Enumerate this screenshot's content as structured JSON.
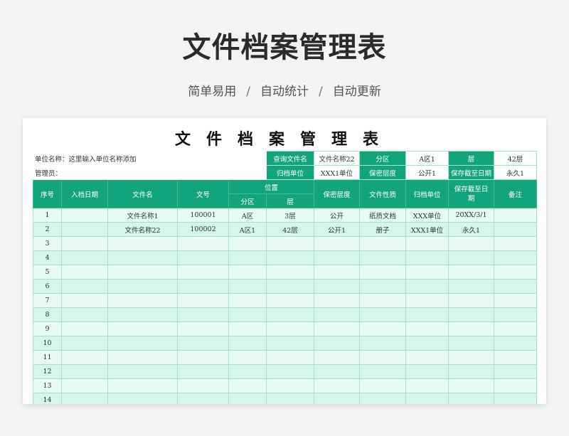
{
  "hero": {
    "title": "文件档案管理表",
    "subtitle_parts": [
      "简单易用",
      "自动统计",
      "自动更新"
    ],
    "separator": "/"
  },
  "sheet": {
    "title": "文件档案管理表",
    "info": {
      "unit_label": "单位名称：这里输入单位名称添加",
      "manager_label": "管理员：",
      "row1": [
        {
          "label": "查询文件名",
          "value": "文件名称22"
        },
        {
          "label": "分区",
          "value": "A区1"
        },
        {
          "label": "层",
          "value": "42层"
        }
      ],
      "row2": [
        {
          "label": "归档单位",
          "value": "XXX1单位"
        },
        {
          "label": "保密层度",
          "value": "公开1"
        },
        {
          "label": "保存截至日期",
          "value": "永久1"
        }
      ]
    },
    "headers": {
      "seq": "序号",
      "date": "入档日期",
      "filename": "文件名",
      "docno": "文号",
      "location": "位置",
      "zone": "分区",
      "floor": "层",
      "secrecy": "保密层度",
      "nature": "文件性质",
      "unit": "归档单位",
      "keep_until": "保存截至日期",
      "remark": "备注"
    },
    "rows": [
      {
        "seq": "1",
        "date": "",
        "filename": "文件名称1",
        "docno": "100001",
        "zone": "A区",
        "floor": "3层",
        "secrecy": "公开",
        "nature": "纸质文档",
        "unit": "XXX单位",
        "keep_until": "20XX/3/1",
        "remark": ""
      },
      {
        "seq": "2",
        "date": "",
        "filename": "文件名称22",
        "docno": "100002",
        "zone": "A区1",
        "floor": "42层",
        "secrecy": "公开1",
        "nature": "册子",
        "unit": "XXX1单位",
        "keep_until": "永久1",
        "remark": ""
      },
      {
        "seq": "3"
      },
      {
        "seq": "4"
      },
      {
        "seq": "5"
      },
      {
        "seq": "6"
      },
      {
        "seq": "7"
      },
      {
        "seq": "8"
      },
      {
        "seq": "9"
      },
      {
        "seq": "10"
      },
      {
        "seq": "11"
      },
      {
        "seq": "12"
      },
      {
        "seq": "13"
      },
      {
        "seq": "14"
      }
    ]
  },
  "colors": {
    "header_green": "#12a57b",
    "row_light": "#e9fbf5",
    "row_alt": "#d3f5ea",
    "grid_line": "#a9dfcb"
  }
}
